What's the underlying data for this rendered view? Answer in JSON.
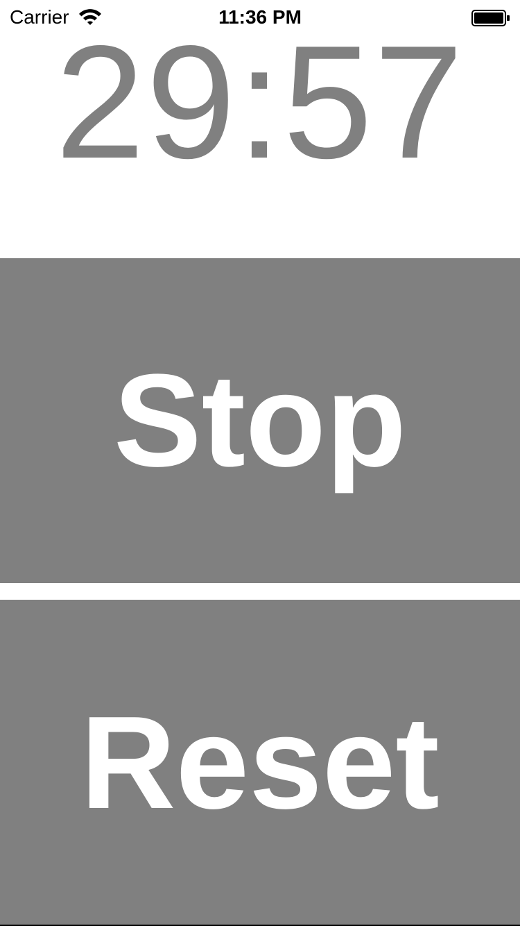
{
  "status_bar": {
    "carrier": "Carrier",
    "time": "11:36 PM",
    "wifi_icon": "wifi-icon",
    "battery_icon": "battery-icon"
  },
  "timer": {
    "display": "29:57"
  },
  "buttons": {
    "stop_label": "Stop",
    "reset_label": "Reset"
  },
  "colors": {
    "button_background": "#808080",
    "button_text": "#ffffff",
    "timer_text": "#808080",
    "background": "#ffffff"
  }
}
